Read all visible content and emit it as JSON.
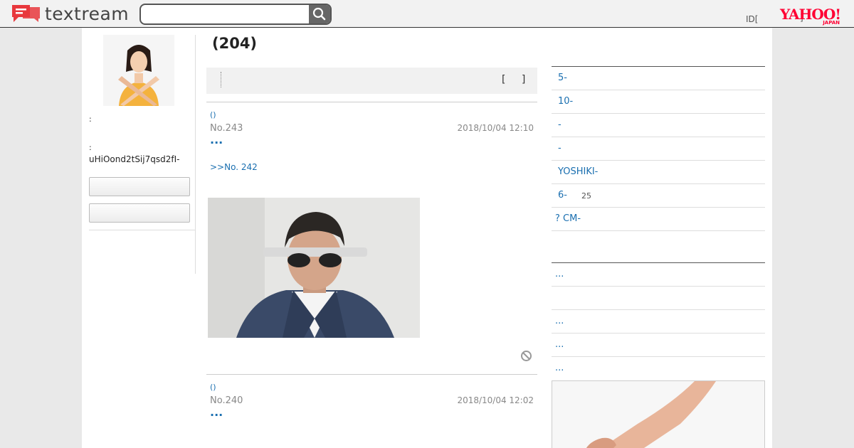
{
  "header": {
    "logo_text": "textream",
    "search_placeholder": "",
    "id_text": "ID[",
    "right_mark": "]",
    "yahoo_main": "YAHOO!",
    "yahoo_sub": "JAPAN"
  },
  "profile": {
    "label_1": ":",
    "label_2": ":",
    "user_id": "uHiOond2tSij7qsd2fI-",
    "button_1_label": "",
    "button_2_label": ""
  },
  "board": {
    "title": "(204)",
    "toolbar_bracket": "[ ]"
  },
  "posts": [
    {
      "link": "()",
      "number": "No.243",
      "date": "2018/10/04 12:10",
      "dots": "...",
      "reply": ">>No. 242"
    },
    {
      "link": "()",
      "number": "No.240",
      "date": "2018/10/04 12:02",
      "dots": "..."
    }
  ],
  "sidebar": {
    "items": [
      {
        "label": "5-",
        "count": ""
      },
      {
        "label": "10-",
        "count": ""
      },
      {
        "label": "-",
        "count": ""
      },
      {
        "label": "-",
        "count": ""
      },
      {
        "label": "YOSHIKI-",
        "count": ""
      },
      {
        "label": "6-",
        "count": "25"
      },
      {
        "label": "? CM-",
        "count": ""
      }
    ],
    "items2": [
      {
        "label": "..."
      },
      {
        "label": ""
      },
      {
        "label": "..."
      },
      {
        "label": "..."
      },
      {
        "label": "..."
      }
    ]
  },
  "colors": {
    "logo_red": "#e8383d",
    "link_blue": "#1a6fb0",
    "yahoo_red": "#ff0033"
  }
}
